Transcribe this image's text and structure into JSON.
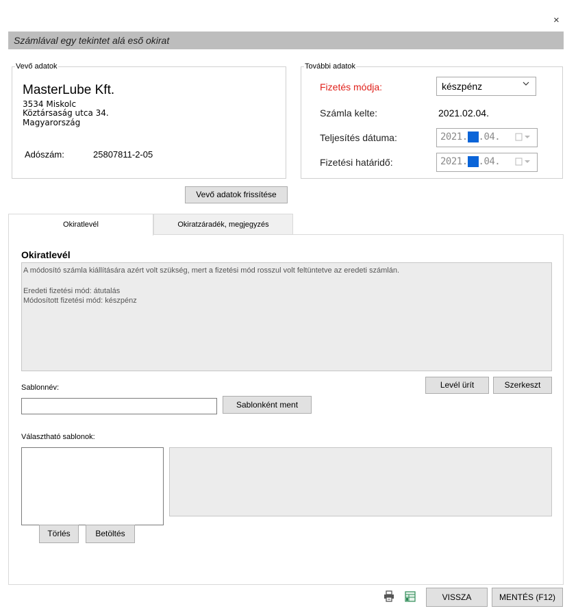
{
  "window": {
    "title": "Számlával egy tekintet alá eső okirat",
    "close_glyph": "×"
  },
  "buyer": {
    "legend": "Vevő adatok",
    "name": "MasterLube Kft.",
    "address_line1": "3534 Miskolc",
    "address_line2": "Köztársaság utca 34.",
    "address_line3": "Magyarország",
    "tax_label": "Adószám:",
    "tax_value": "25807811-2-05",
    "refresh_button": "Vevő adatok frissítése"
  },
  "extra": {
    "legend": "További adatok",
    "payment_label": "Fizetés módja:",
    "payment_value": "készpénz",
    "invoice_date_label": "Számla kelte:",
    "invoice_date_value": "2021.02.04.",
    "performance_date_label": "Teljesítés dátuma:",
    "performance_date": {
      "year": "2021.",
      "month": "02",
      "day": ".04."
    },
    "due_date_label": "Fizetési határidő:",
    "due_date": {
      "year": "2021.",
      "month": "02",
      "day": ".04."
    }
  },
  "tabs": [
    {
      "label": "Okiratlevél",
      "active": true
    },
    {
      "label": "Okiratzáradék, megjegyzés",
      "active": false
    }
  ],
  "letter": {
    "section_title": "Okiratlevél",
    "line1": "A módosító számla kiállítására azért volt szükség, mert a fizetési mód rosszul volt feltüntetve az eredeti számlán.",
    "line2": "Eredeti fizetési mód: átutalás",
    "line3": "Módosított fizetési mód: készpénz",
    "clear_button": "Levél ürít",
    "edit_button": "Szerkeszt"
  },
  "template": {
    "name_label": "Sablonnév:",
    "name_value": "",
    "save_button": "Sablonként ment",
    "available_label": "Választható sablonok:",
    "delete_button": "Törlés",
    "load_button": "Betöltés"
  },
  "footer": {
    "print_icon": "printer-icon",
    "sheet_icon": "spreadsheet-icon",
    "back_button": "VISSZA",
    "save_button": "MENTÉS (F12)"
  },
  "colors": {
    "title_bar": "#bdbdbd",
    "required_label": "#e0211b",
    "date_highlight": "#0a64d8",
    "sheet_icon": "#2e8b57"
  }
}
